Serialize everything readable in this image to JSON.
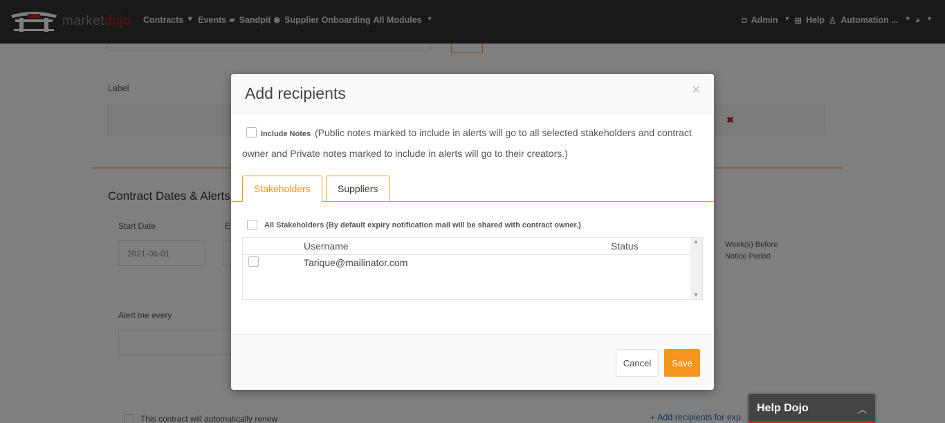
{
  "nav": {
    "brand_part1": "market",
    "brand_part2": "dojo",
    "items": [
      {
        "label": "Contracts"
      },
      {
        "label": "Events"
      },
      {
        "label": "Sandpit"
      },
      {
        "label": "Supplier Onboarding"
      },
      {
        "label": "All Modules"
      }
    ],
    "right": {
      "admin": "Admin",
      "help": "Help",
      "user": "Automation ..."
    }
  },
  "background": {
    "label_field_label": "Label",
    "section_title": "Contract Dates & Alerts",
    "start_date_label": "Start Date",
    "start_date_value": "2021-06-01",
    "end_label_fragment": "E",
    "alert_label": "Alert me every",
    "weeks_line1": "Week(s) Before",
    "weeks_line2": "Notice Period",
    "renew_label": "This contract will automatically renew",
    "add_recipients_link": "+ Add recipients for exp"
  },
  "modal": {
    "title": "Add recipients",
    "close_symbol": "×",
    "include_notes_label": "Include Notes",
    "include_notes_desc": "(Public notes marked to include in alerts will go to all selected stakeholders and contract owner and Private notes marked to include in alerts will go to their creators.)",
    "tabs": [
      {
        "label": "Stakeholders",
        "active": true
      },
      {
        "label": "Suppliers",
        "active": false
      }
    ],
    "all_stakeholders_label": "All Stakeholders (By default expiry notification mail will be shared with contract owner.)",
    "grid": {
      "columns": [
        "Username",
        "Status"
      ],
      "rows": [
        {
          "username": "Tarique@mailinator.com",
          "status": ""
        }
      ]
    },
    "buttons": {
      "cancel": "Cancel",
      "save": "Save"
    }
  },
  "help_dojo": {
    "title": "Help Dojo"
  },
  "colors": {
    "accent": "#f7941d",
    "nav_bg": "#333333",
    "brand_red": "#c6242b"
  }
}
